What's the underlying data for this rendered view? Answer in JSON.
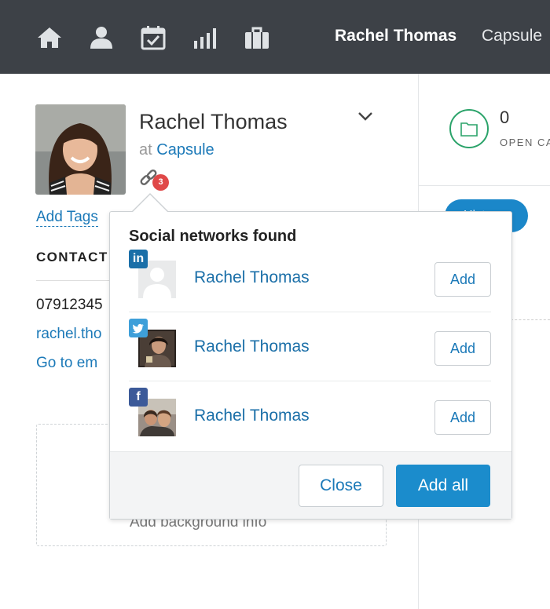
{
  "nav": {
    "icons": [
      "home-icon",
      "person-icon",
      "calendar-check-icon",
      "signal-bars-icon",
      "briefcase-icon"
    ],
    "user_name": "Rachel Thomas",
    "company": "Capsule"
  },
  "party": {
    "name": "Rachel Thomas",
    "at_prefix": "at",
    "company": "Capsule",
    "link_badge_count": "3",
    "add_tags": "Add Tags"
  },
  "contact": {
    "heading": "CONTACT",
    "phone": "07912345",
    "email": "rachel.tho",
    "goto_email": "Go to em"
  },
  "background": {
    "placeholder": "Add background info"
  },
  "summary": {
    "open_cases_count": "0",
    "open_cases_label": "OPEN CA",
    "history_button": "Hist"
  },
  "popover": {
    "title": "Social networks found",
    "networks": [
      {
        "network": "linkedin",
        "badge": "in",
        "color": "#1a6fa8",
        "name": "Rachel Thomas",
        "add_label": "Add"
      },
      {
        "network": "twitter",
        "badge": "t",
        "color": "#3e9fd9",
        "name": "Rachel Thomas",
        "add_label": "Add"
      },
      {
        "network": "facebook",
        "badge": "f",
        "color": "#3c5a99",
        "name": "Rachel Thomas",
        "add_label": "Add"
      }
    ],
    "close_label": "Close",
    "add_all_label": "Add all"
  },
  "colors": {
    "nav_bg": "#3d4147",
    "link_blue": "#1b79b8",
    "primary_button": "#1b8ccc",
    "badge_red": "#e04848",
    "open_cases_green": "#2ba36a"
  }
}
